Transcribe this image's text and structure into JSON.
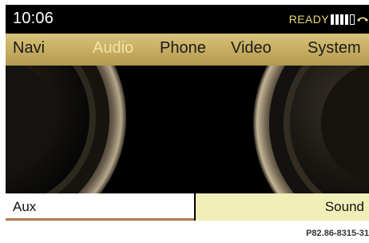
{
  "status": {
    "time": "10:06",
    "ready_text": "READY"
  },
  "nav": {
    "items": [
      {
        "label": "Navi",
        "active": false
      },
      {
        "label": "Audio",
        "active": true
      },
      {
        "label": "Phone",
        "active": false
      },
      {
        "label": "Video",
        "active": false
      },
      {
        "label": "System",
        "active": false
      }
    ]
  },
  "softkeys": {
    "left_label": "Aux",
    "right_label": "Sound"
  },
  "caption": "P82.86-8315-31",
  "icons": {
    "signal": "signal-strength-icon",
    "phone": "phone-handset-icon",
    "speakers": "speaker-graphic"
  },
  "colors": {
    "nav_bar": "#c7ae62",
    "active_tab_text": "#f3e3a4",
    "ready_text": "#e8d77a",
    "sound_key_bg": "#f1efb8"
  }
}
